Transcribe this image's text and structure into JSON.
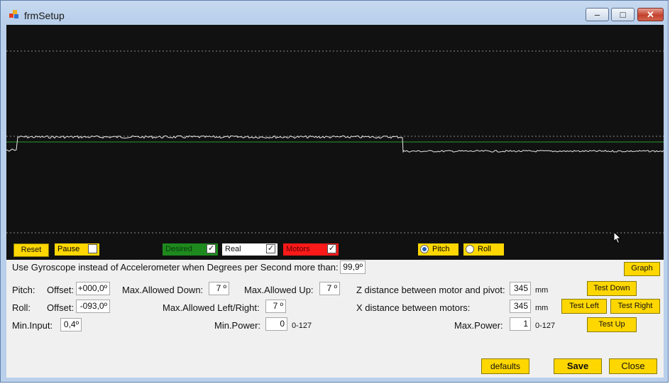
{
  "window": {
    "title": "frmSetup",
    "minimize_label": "–",
    "maximize_label": "□",
    "close_label": "✕"
  },
  "graph_controls": {
    "reset_label": "Reset",
    "pause_label": "Pause",
    "pause_checked": false,
    "desired_label": "Desired",
    "desired_checked": true,
    "real_label": "Real",
    "real_checked": true,
    "motors_label": "Motors",
    "motors_checked": true,
    "pitch_label": "Pitch",
    "pitch_selected": true,
    "roll_label": "Roll",
    "roll_selected": false,
    "check_mark": "✓"
  },
  "colors": {
    "graph_bg": "#111111",
    "accent_yellow": "#ffd700",
    "desired_green": "#1e8a1e",
    "motors_red": "#ff1a1a",
    "trace_white": "#e8e8e8",
    "trace_green": "#2a9a2a"
  },
  "settings": {
    "gyro_label": "Use Gyroscope instead of Accelerometer when Degrees per Second more than:",
    "gyro_value": "99,9º",
    "graph_button": "Graph",
    "pitch_label": "Pitch:",
    "pitch_offset_label": "Offset:",
    "pitch_offset_value": "+000,0º",
    "max_allowed_down_label": "Max.Allowed Down:",
    "max_allowed_down_value": "7 º",
    "max_allowed_up_label": "Max.Allowed Up:",
    "max_allowed_up_value": "7 º",
    "z_distance_label": "Z distance between motor and pivot:",
    "z_distance_value": "345",
    "z_unit": "mm",
    "test_down_button": "Test Down",
    "roll_label": "Roll:",
    "roll_offset_label": "Offset:",
    "roll_offset_value": "-093,0º",
    "max_allowed_lr_label": "Max.Allowed Left/Right:",
    "max_allowed_lr_value": "7 º",
    "x_distance_label": "X distance between motors:",
    "x_distance_value": "345",
    "x_unit": "mm",
    "test_left_button": "Test Left",
    "test_right_button": "Test Right",
    "min_input_label": "Min.Input:",
    "min_input_value": "0,4º",
    "min_power_label": "Min.Power:",
    "min_power_value": "0",
    "min_power_range": "0-127",
    "max_power_label": "Max.Power:",
    "max_power_value": "1",
    "max_power_range": "0-127",
    "test_up_button": "Test Up"
  },
  "footer": {
    "defaults_button": "defaults",
    "save_button": "Save",
    "close_button": "Close"
  }
}
